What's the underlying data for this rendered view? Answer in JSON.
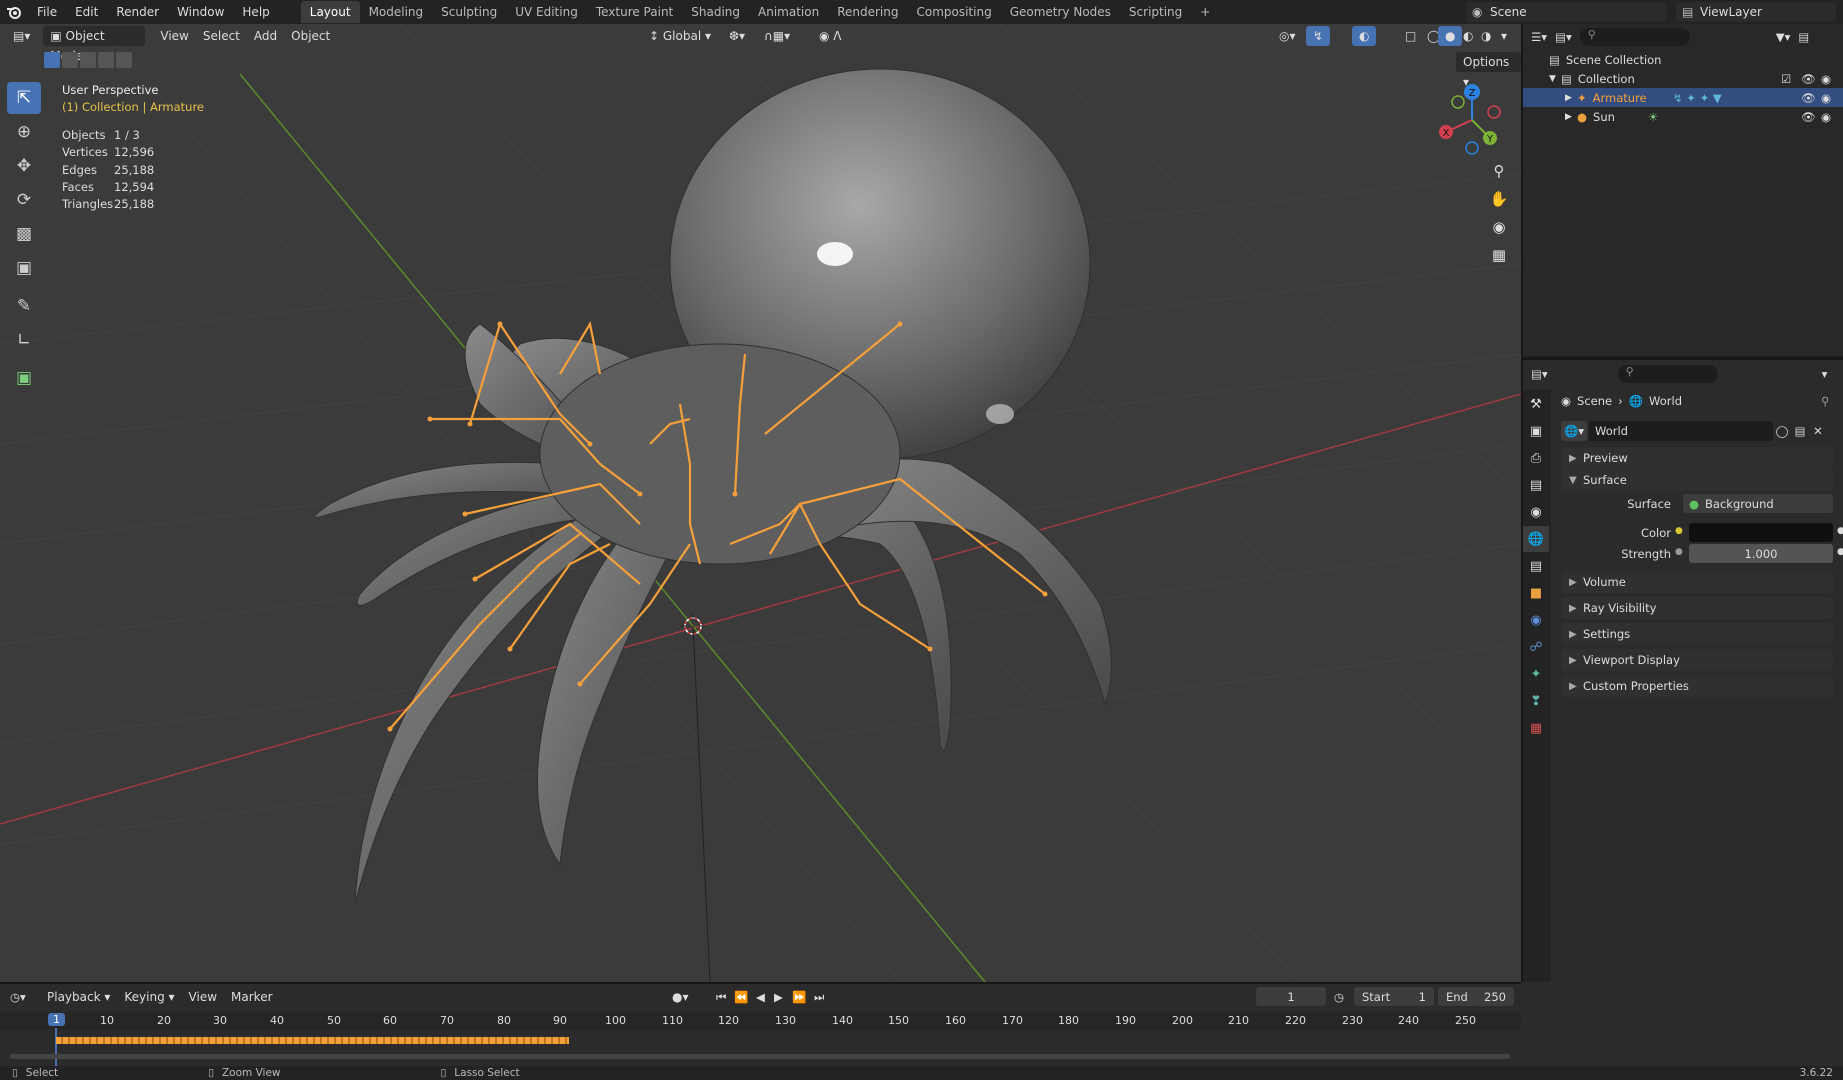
{
  "menubar": {
    "items": [
      "File",
      "Edit",
      "Render",
      "Window",
      "Help"
    ],
    "workspaces": [
      "Layout",
      "Modeling",
      "Sculpting",
      "UV Editing",
      "Texture Paint",
      "Shading",
      "Animation",
      "Rendering",
      "Compositing",
      "Geometry Nodes",
      "Scripting"
    ],
    "active_workspace": "Layout",
    "add_tab": "+",
    "scene": "Scene",
    "view_layer": "ViewLayer"
  },
  "viewport": {
    "mode": "Object Mode",
    "menus": [
      "View",
      "Select",
      "Add",
      "Object"
    ],
    "orientation": "Global",
    "options_label": "Options",
    "perspective": "User Perspective",
    "collection_info": "(1) Collection | Armature",
    "stats": [
      {
        "label": "Objects",
        "value": "1 / 3"
      },
      {
        "label": "Vertices",
        "value": "12,596"
      },
      {
        "label": "Edges",
        "value": "25,188"
      },
      {
        "label": "Faces",
        "value": "12,594"
      },
      {
        "label": "Triangles",
        "value": "25,188"
      }
    ],
    "gizmo_axes": {
      "x": "X",
      "y": "Y",
      "z": "Z"
    },
    "colors": {
      "x_axis": "#d2404e",
      "y_axis": "#7cb236",
      "z_axis": "#2f83e0",
      "bones": "#f5a03a",
      "selected": "#4772b3"
    }
  },
  "outliner": {
    "root": "Scene Collection",
    "collection": "Collection",
    "items": [
      {
        "name": "Armature",
        "selected": true
      },
      {
        "name": "Sun",
        "selected": false
      }
    ]
  },
  "properties": {
    "breadcrumb": [
      "Scene",
      "World"
    ],
    "datablock": "World",
    "panels": {
      "preview": "Preview",
      "surface": "Surface",
      "volume": "Volume",
      "ray_visibility": "Ray Visibility",
      "settings": "Settings",
      "viewport_display": "Viewport Display",
      "custom_properties": "Custom Properties"
    },
    "surface_label": "Surface",
    "surface_value": "Background",
    "color_label": "Color",
    "strength_label": "Strength",
    "strength_value": "1.000"
  },
  "timeline": {
    "menus": [
      "Playback",
      "Keying",
      "View",
      "Marker"
    ],
    "current_frame": "1",
    "start_label": "Start",
    "start": "1",
    "end_label": "End",
    "end": "250",
    "ticks": [
      "1",
      "10",
      "20",
      "30",
      "40",
      "50",
      "60",
      "70",
      "80",
      "90",
      "100",
      "110",
      "120",
      "130",
      "140",
      "150",
      "160",
      "170",
      "180",
      "190",
      "200",
      "210",
      "220",
      "230",
      "240",
      "250"
    ]
  },
  "statusbar": {
    "select": "Select",
    "zoom": "Zoom View",
    "lasso": "Lasso Select",
    "version": "3.6.22"
  }
}
